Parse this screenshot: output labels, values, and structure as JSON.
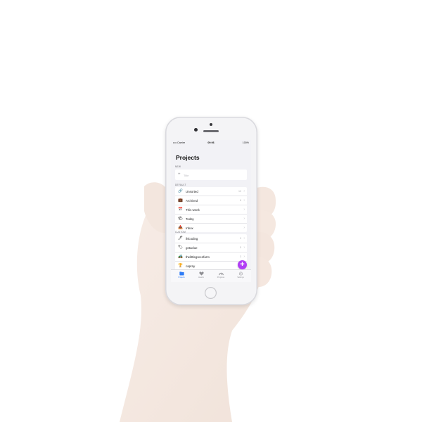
{
  "status": {
    "carrier": "•••• Carrier",
    "time": "09:06",
    "battery": "100%"
  },
  "page": {
    "title": "Projects"
  },
  "sections": {
    "new": "NEW",
    "default": "DEFAULT",
    "custom": "CUSTOM"
  },
  "new_item": {
    "placeholder": "Title"
  },
  "default_items": [
    {
      "label": "Unsorted",
      "icon": "link-icon",
      "glyph": "🔗",
      "count": "12"
    },
    {
      "label": "Archived",
      "icon": "archive-icon",
      "glyph": "💼",
      "count": "8"
    },
    {
      "label": "This week",
      "icon": "calendar-icon",
      "glyph": "📅",
      "count": ""
    },
    {
      "label": "Today",
      "icon": "sun-icon",
      "glyph": "🌤",
      "count": ""
    },
    {
      "label": "Inbox",
      "icon": "inbox-icon",
      "glyph": "📥",
      "count": ""
    }
  ],
  "custom_items": [
    {
      "label": "ihlcoding",
      "icon": "pen-icon",
      "glyph": "🖊",
      "count": "9"
    },
    {
      "label": "getaclue",
      "icon": "tag-icon",
      "glyph": "🏷",
      "count": "5"
    },
    {
      "label": "thelittlegreenfarm",
      "icon": "tractor-icon",
      "glyph": "🚜",
      "count": "3"
    },
    {
      "label": "capray",
      "icon": "trophy-icon",
      "glyph": "🏆",
      "count": ""
    }
  ],
  "tabs": [
    {
      "label": "Projects",
      "icon": "projects-icon",
      "active": true
    },
    {
      "label": "Hearts",
      "icon": "heart-icon",
      "active": false
    },
    {
      "label": "Progress",
      "icon": "gauge-icon",
      "active": false
    },
    {
      "label": "Settings",
      "icon": "gear-icon",
      "active": false
    }
  ],
  "colors": {
    "accent": "#b13ef5",
    "tab_active": "#2f7cf6",
    "background": "#f2f2f6"
  }
}
